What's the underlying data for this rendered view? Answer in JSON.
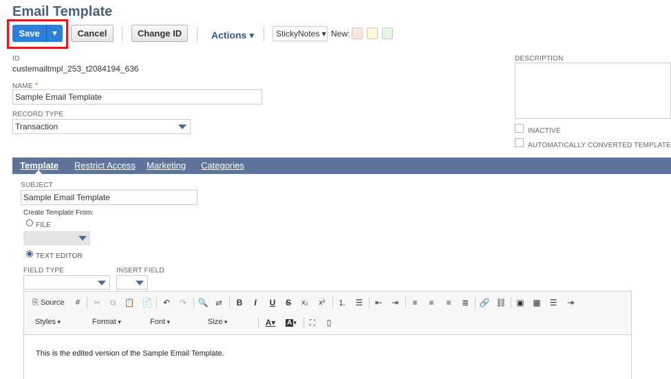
{
  "page": {
    "title": "Email Template"
  },
  "toolbar": {
    "save_label": "Save",
    "save_menu_glyph": "▼",
    "cancel_label": "Cancel",
    "change_id_label": "Change ID",
    "actions_label": "Actions ▾",
    "stickynotes_label": "StickyNotes ▾",
    "new_label": "New:",
    "swatch_colors": [
      "#fde6e6",
      "#fdf7d9",
      "#e4f6e2"
    ]
  },
  "form": {
    "id_label": "ID",
    "id_value": "custemailtmpl_253_t2084194_636",
    "name_label": "NAME",
    "name_required": "*",
    "name_value": "Sample Email Template",
    "record_type_label": "RECORD TYPE",
    "record_type_value": "Transaction",
    "description_label": "DESCRIPTION",
    "inactive_label": "INACTIVE",
    "auto_converted_label": "AUTOMATICALLY CONVERTED TEMPLATE"
  },
  "tabs": [
    {
      "label": "Template",
      "active": true
    },
    {
      "label": "Restrict Access",
      "active": false
    },
    {
      "label": "Marketing",
      "active": false
    },
    {
      "label": "Categories",
      "active": false
    }
  ],
  "template": {
    "subject_label": "SUBJECT",
    "subject_value": "Sample Email Template",
    "create_from_label": "Create Template From:",
    "file_label": "FILE",
    "text_editor_label": "TEXT EDITOR",
    "field_type_label": "FIELD TYPE",
    "insert_field_label": "INSERT FIELD"
  },
  "editor": {
    "source_label": "Source",
    "styles_label": "Styles",
    "format_label": "Format",
    "font_label": "Font",
    "size_label": "Size",
    "content": "This is the edited version of the Sample Email Template."
  }
}
